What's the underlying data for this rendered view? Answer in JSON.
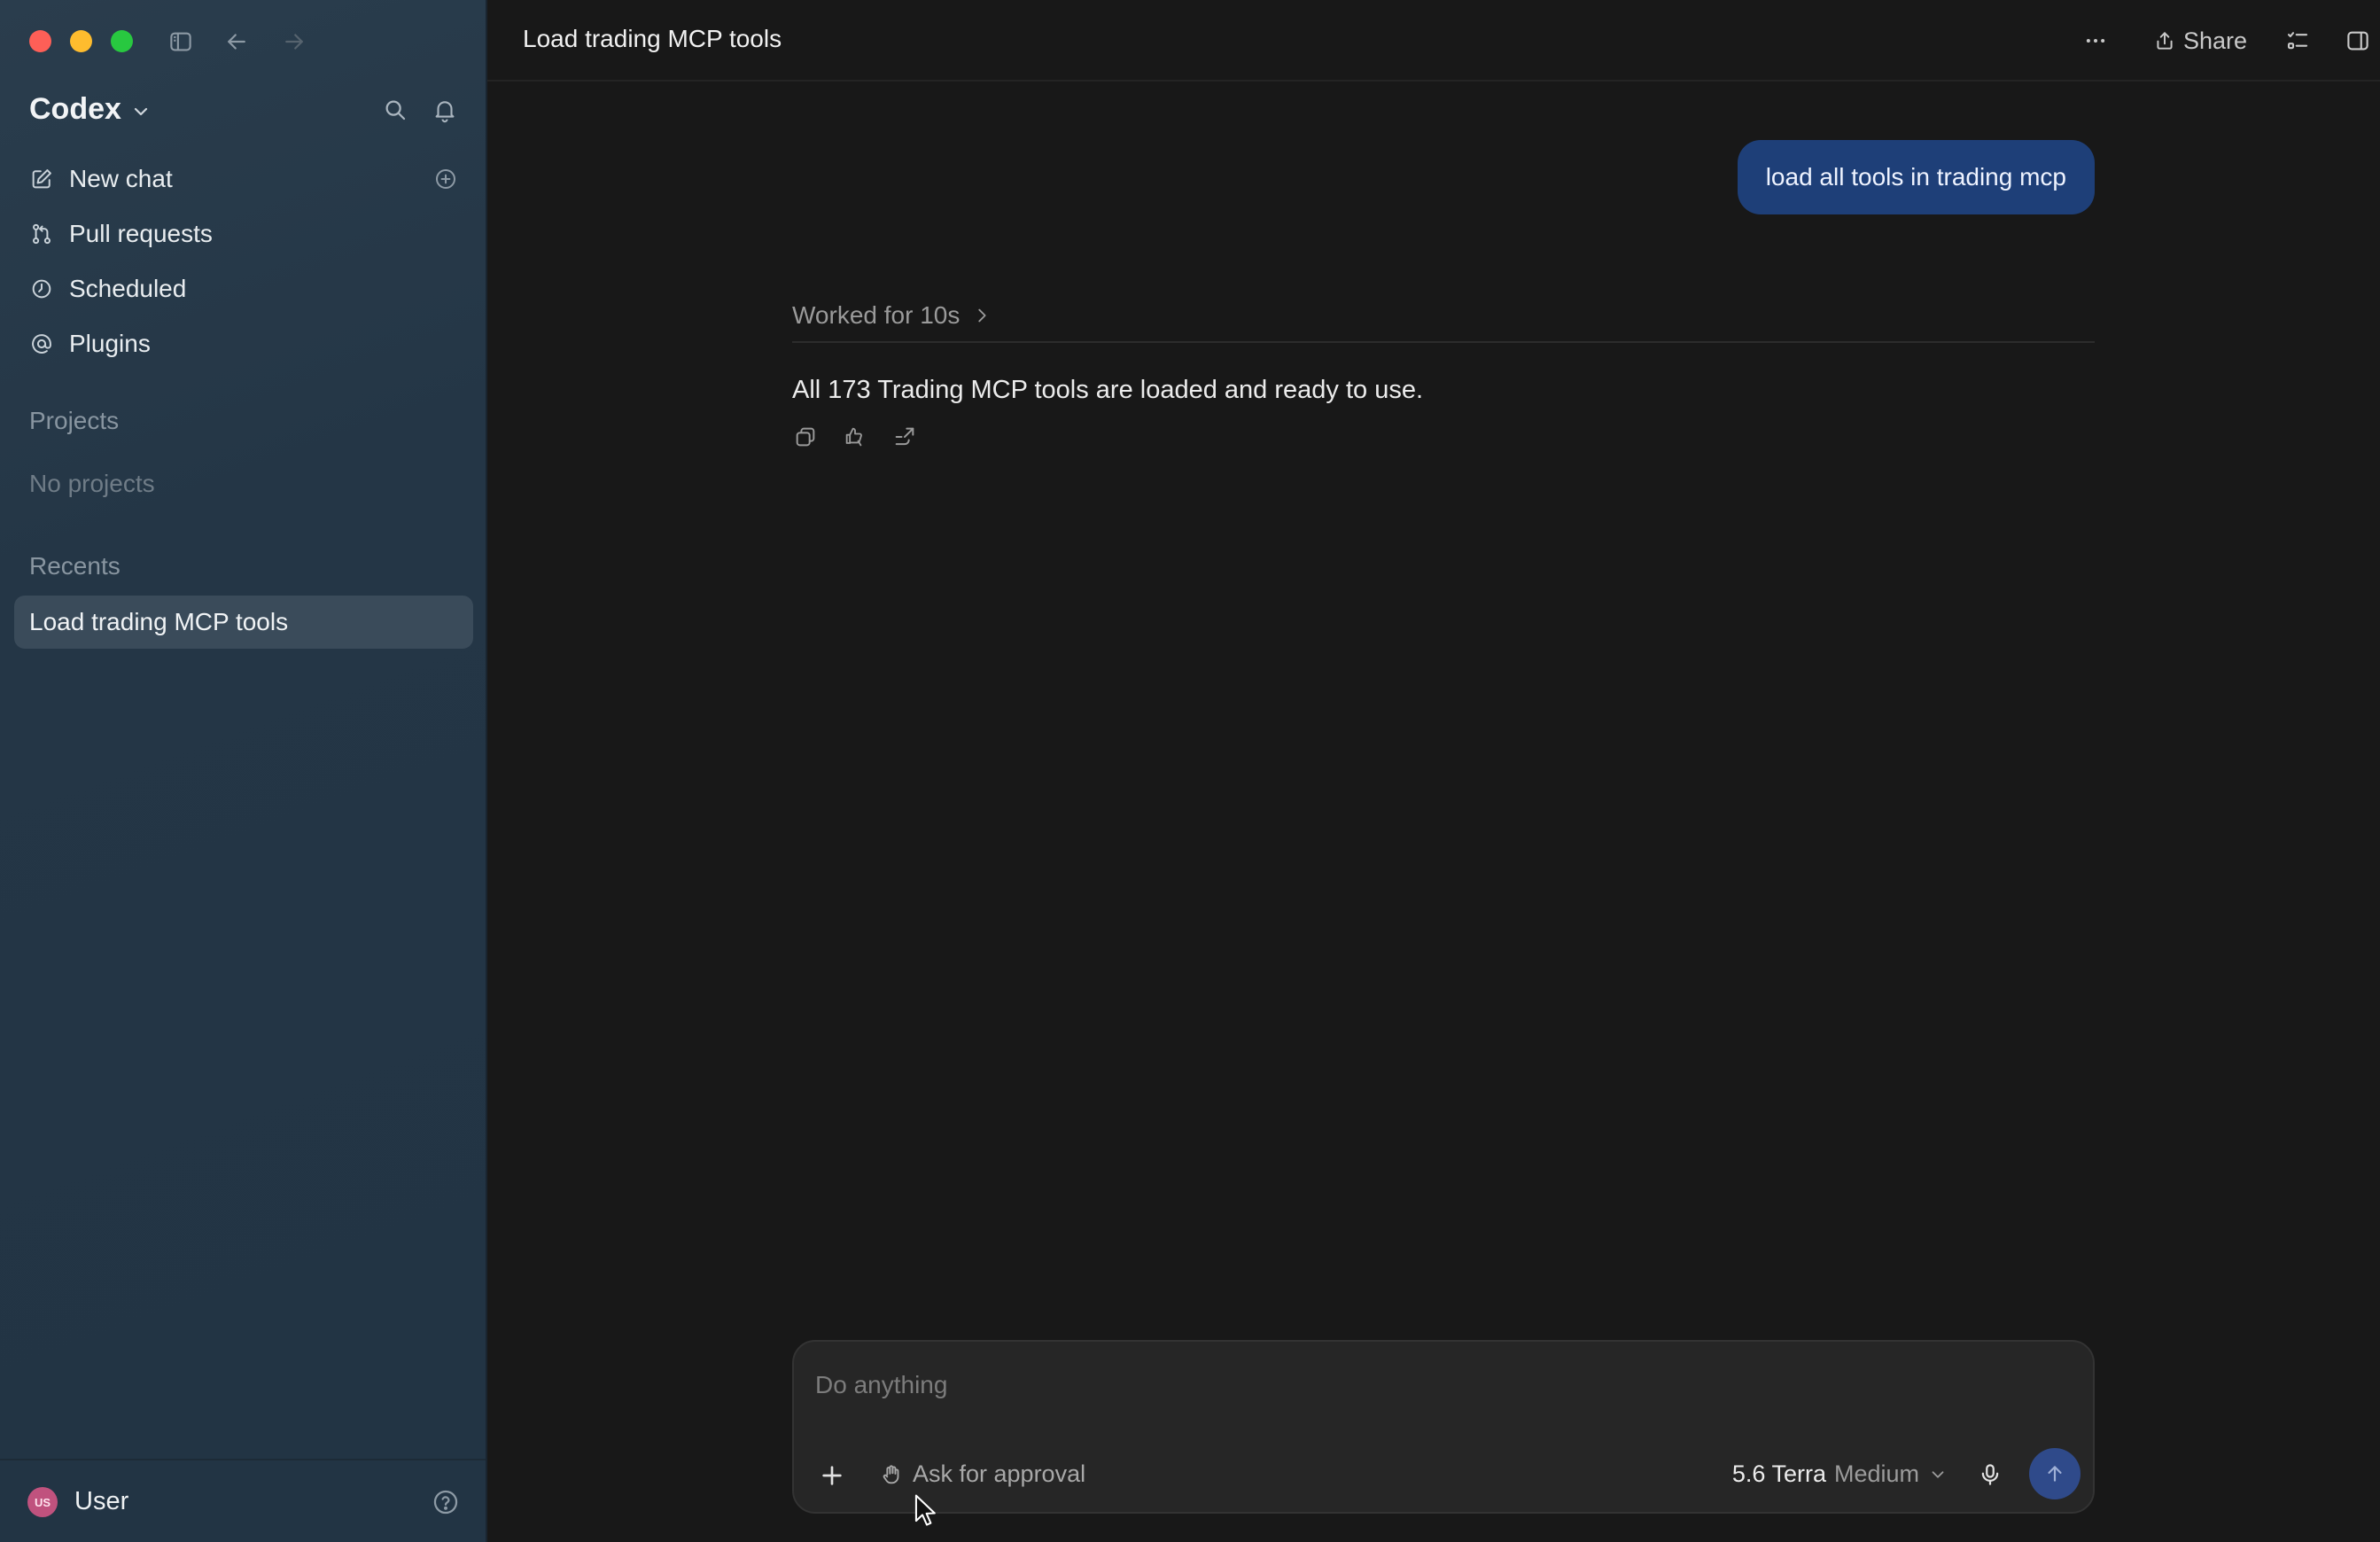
{
  "sidebar": {
    "brand": "Codex",
    "nav": [
      {
        "label": "New chat",
        "icon": "edit-icon"
      },
      {
        "label": "Pull requests",
        "icon": "pull-request-icon"
      },
      {
        "label": "Scheduled",
        "icon": "clock-icon"
      },
      {
        "label": "Plugins",
        "icon": "at-sign-icon"
      }
    ],
    "projects_label": "Projects",
    "projects_empty": "No projects",
    "recents_label": "Recents",
    "recents": [
      {
        "label": "Load trading MCP tools"
      }
    ],
    "user": {
      "name": "User",
      "initials": "US",
      "avatar_color": "#c0527e"
    }
  },
  "header": {
    "title": "Load trading MCP tools",
    "share_label": "Share"
  },
  "conversation": {
    "user_message": "load all tools in trading mcp",
    "worked_label": "Worked for 10s",
    "assistant_message": "All 173 Trading MCP tools are loaded and ready to use."
  },
  "composer": {
    "placeholder": "Do anything",
    "approval_label": "Ask for approval",
    "model_name": "5.6 Terra",
    "model_effort": "Medium"
  },
  "colors": {
    "accent": "#1e3f78",
    "send_button": "#2f4a8a",
    "sidebar_bg": "#243646",
    "main_bg": "#181818"
  }
}
